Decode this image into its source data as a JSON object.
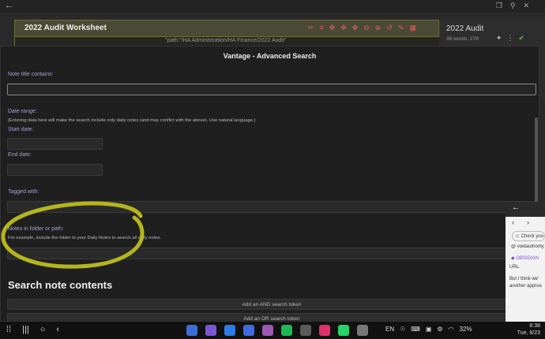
{
  "topbar": {
    "back_glyph": "←",
    "icons": [
      "copy-icon",
      "pin-icon",
      "close-icon"
    ]
  },
  "note": {
    "title": "2022 Audit Worksheet",
    "path": "\"path:\"/HA Administration/HA Finance/2022 Audit\""
  },
  "right_panel": {
    "title": "2022 Audit",
    "stats": "38 words, 278"
  },
  "modal": {
    "title": "Vantage - Advanced Search",
    "note_title_label": "Note title contains:",
    "date_range_label": "Date range:",
    "date_range_desc": "(Entering data here will make the search include only daily notes (and may conflict with the above). Use natural language.)",
    "start_date_label": "Start date:",
    "end_date_label": "End date:",
    "tagged_label": "Tagged with:",
    "folder_label": "Notes in folder or path:",
    "folder_desc": "For example, include the folder to your Daily Notes to search all daily notes.",
    "search_contents_title": "Search note contents",
    "add_and_label": "Add an AND search token",
    "add_or_label": "Add an OR search token"
  },
  "annotation": {
    "color": "#b5b51e"
  },
  "float_panel": {
    "check_label": "Check you",
    "user": "voidauthority",
    "brand": "OBSIDIAN",
    "url_fragment": "URL.",
    "message_line1": "But I think we'",
    "message_line2": "another approa"
  },
  "taskbar": {
    "language": "EN",
    "battery": "32%",
    "time": "8:38",
    "date": "Tue, 8/23",
    "app_colors": [
      "#3b6fd8",
      "#7a56d6",
      "#2c7be5",
      "#4169e1",
      "#9b59b6",
      "#1db954",
      "#5a5a5a",
      "#e1306c",
      "#25d366",
      "#777777"
    ]
  }
}
